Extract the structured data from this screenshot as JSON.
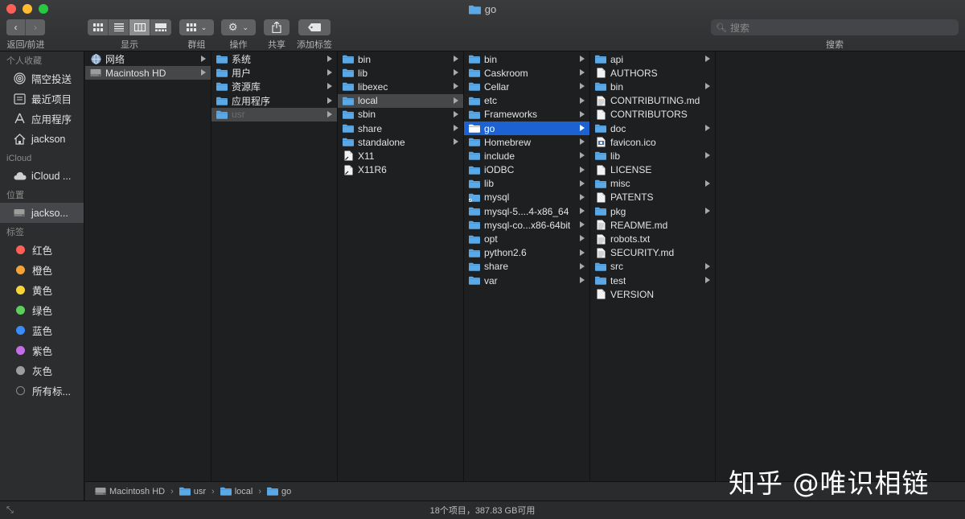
{
  "window": {
    "title": "go"
  },
  "toolbar": {
    "nav_label": "返回/前进",
    "view_label": "显示",
    "group_label": "群组",
    "action_label": "操作",
    "share_label": "共享",
    "tag_label": "添加标签",
    "search_placeholder": "搜索",
    "search_label": "搜索"
  },
  "sidebar": {
    "favorites_header": "个人收藏",
    "favorites": [
      {
        "label": "隔空投送",
        "icon": "airdrop-icon"
      },
      {
        "label": "最近项目",
        "icon": "recents-icon"
      },
      {
        "label": "应用程序",
        "icon": "applications-icon"
      },
      {
        "label": "jackson",
        "icon": "home-icon"
      }
    ],
    "icloud_header": "iCloud",
    "icloud": [
      {
        "label": "iCloud ...",
        "icon": "cloud-icon"
      }
    ],
    "locations_header": "位置",
    "locations": [
      {
        "label": "jackso...",
        "icon": "disk-icon"
      }
    ],
    "tags_header": "标签",
    "tags": [
      {
        "label": "红色",
        "color": "#fe5f57"
      },
      {
        "label": "橙色",
        "color": "#f5a236"
      },
      {
        "label": "黄色",
        "color": "#f8d43b"
      },
      {
        "label": "绿色",
        "color": "#5bd15c"
      },
      {
        "label": "蓝色",
        "color": "#3b8cf6"
      },
      {
        "label": "紫色",
        "color": "#c66de8"
      },
      {
        "label": "灰色",
        "color": "#9d9d9f"
      },
      {
        "label": "所有标...",
        "color": ""
      }
    ]
  },
  "columns": [
    {
      "items": [
        {
          "label": "网络",
          "icon": "globe-icon",
          "arrow": true
        },
        {
          "label": "Macintosh HD",
          "icon": "disk-icon",
          "arrow": true,
          "state": "parent-selected"
        }
      ]
    },
    {
      "items": [
        {
          "label": "系统",
          "icon": "folder-icon",
          "arrow": true
        },
        {
          "label": "用户",
          "icon": "folder-icon",
          "arrow": true
        },
        {
          "label": "资源库",
          "icon": "folder-icon",
          "arrow": true
        },
        {
          "label": "应用程序",
          "icon": "folder-icon",
          "arrow": true
        },
        {
          "label": "usr",
          "icon": "folder-icon",
          "arrow": true,
          "state": "parent-selected-dim"
        }
      ]
    },
    {
      "items": [
        {
          "label": "bin",
          "icon": "folder-icon",
          "arrow": true
        },
        {
          "label": "lib",
          "icon": "folder-icon",
          "arrow": true
        },
        {
          "label": "libexec",
          "icon": "folder-icon",
          "arrow": true
        },
        {
          "label": "local",
          "icon": "folder-icon",
          "arrow": true,
          "state": "parent-selected"
        },
        {
          "label": "sbin",
          "icon": "folder-icon",
          "arrow": true
        },
        {
          "label": "share",
          "icon": "folder-icon",
          "arrow": true
        },
        {
          "label": "standalone",
          "icon": "folder-icon",
          "arrow": true
        },
        {
          "label": "X11",
          "icon": "alias-icon",
          "arrow": false
        },
        {
          "label": "X11R6",
          "icon": "alias-icon",
          "arrow": false
        }
      ]
    },
    {
      "items": [
        {
          "label": "bin",
          "icon": "folder-icon",
          "arrow": true
        },
        {
          "label": "Caskroom",
          "icon": "folder-icon",
          "arrow": true
        },
        {
          "label": "Cellar",
          "icon": "folder-icon",
          "arrow": true
        },
        {
          "label": "etc",
          "icon": "folder-icon",
          "arrow": true
        },
        {
          "label": "Frameworks",
          "icon": "folder-icon",
          "arrow": true
        },
        {
          "label": "go",
          "icon": "folder-icon",
          "arrow": true,
          "state": "active-selected"
        },
        {
          "label": "Homebrew",
          "icon": "folder-icon",
          "arrow": true
        },
        {
          "label": "include",
          "icon": "folder-icon",
          "arrow": true
        },
        {
          "label": "iODBC",
          "icon": "folder-icon",
          "arrow": true
        },
        {
          "label": "lib",
          "icon": "folder-icon",
          "arrow": true
        },
        {
          "label": "mysql",
          "icon": "folder-alias-icon",
          "arrow": true
        },
        {
          "label": "mysql-5....4-x86_64",
          "icon": "folder-icon",
          "arrow": true
        },
        {
          "label": "mysql-co...x86-64bit",
          "icon": "folder-icon",
          "arrow": true
        },
        {
          "label": "opt",
          "icon": "folder-icon",
          "arrow": true
        },
        {
          "label": "python2.6",
          "icon": "folder-icon",
          "arrow": true
        },
        {
          "label": "share",
          "icon": "folder-icon",
          "arrow": true
        },
        {
          "label": "var",
          "icon": "folder-icon",
          "arrow": true
        }
      ]
    },
    {
      "items": [
        {
          "label": "api",
          "icon": "folder-icon",
          "arrow": true
        },
        {
          "label": "AUTHORS",
          "icon": "document-icon",
          "arrow": false
        },
        {
          "label": "bin",
          "icon": "folder-icon",
          "arrow": true
        },
        {
          "label": "CONTRIBUTING.md",
          "icon": "text-document-icon",
          "arrow": false
        },
        {
          "label": "CONTRIBUTORS",
          "icon": "document-icon",
          "arrow": false
        },
        {
          "label": "doc",
          "icon": "folder-icon",
          "arrow": true
        },
        {
          "label": "favicon.ico",
          "icon": "image-document-icon",
          "arrow": false
        },
        {
          "label": "lib",
          "icon": "folder-icon",
          "arrow": true
        },
        {
          "label": "LICENSE",
          "icon": "document-icon",
          "arrow": false
        },
        {
          "label": "misc",
          "icon": "folder-icon",
          "arrow": true
        },
        {
          "label": "PATENTS",
          "icon": "document-icon",
          "arrow": false
        },
        {
          "label": "pkg",
          "icon": "folder-icon",
          "arrow": true
        },
        {
          "label": "README.md",
          "icon": "text-document-icon",
          "arrow": false
        },
        {
          "label": "robots.txt",
          "icon": "text-document-icon",
          "arrow": false
        },
        {
          "label": "SECURITY.md",
          "icon": "text-document-icon",
          "arrow": false
        },
        {
          "label": "src",
          "icon": "folder-icon",
          "arrow": true
        },
        {
          "label": "test",
          "icon": "folder-icon",
          "arrow": true
        },
        {
          "label": "VERSION",
          "icon": "document-icon",
          "arrow": false
        }
      ]
    },
    {
      "items": []
    }
  ],
  "pathbar": [
    {
      "label": "Macintosh HD",
      "icon": "disk-icon"
    },
    {
      "label": "usr",
      "icon": "folder-icon"
    },
    {
      "label": "local",
      "icon": "folder-icon"
    },
    {
      "label": "go",
      "icon": "folder-icon"
    }
  ],
  "status": {
    "text": "18个项目，387.83 GB可用"
  },
  "watermark": {
    "text": "知乎 @唯识相链"
  },
  "colors": {
    "accent": "#1d62d3",
    "folder": "#5aa9e6"
  }
}
